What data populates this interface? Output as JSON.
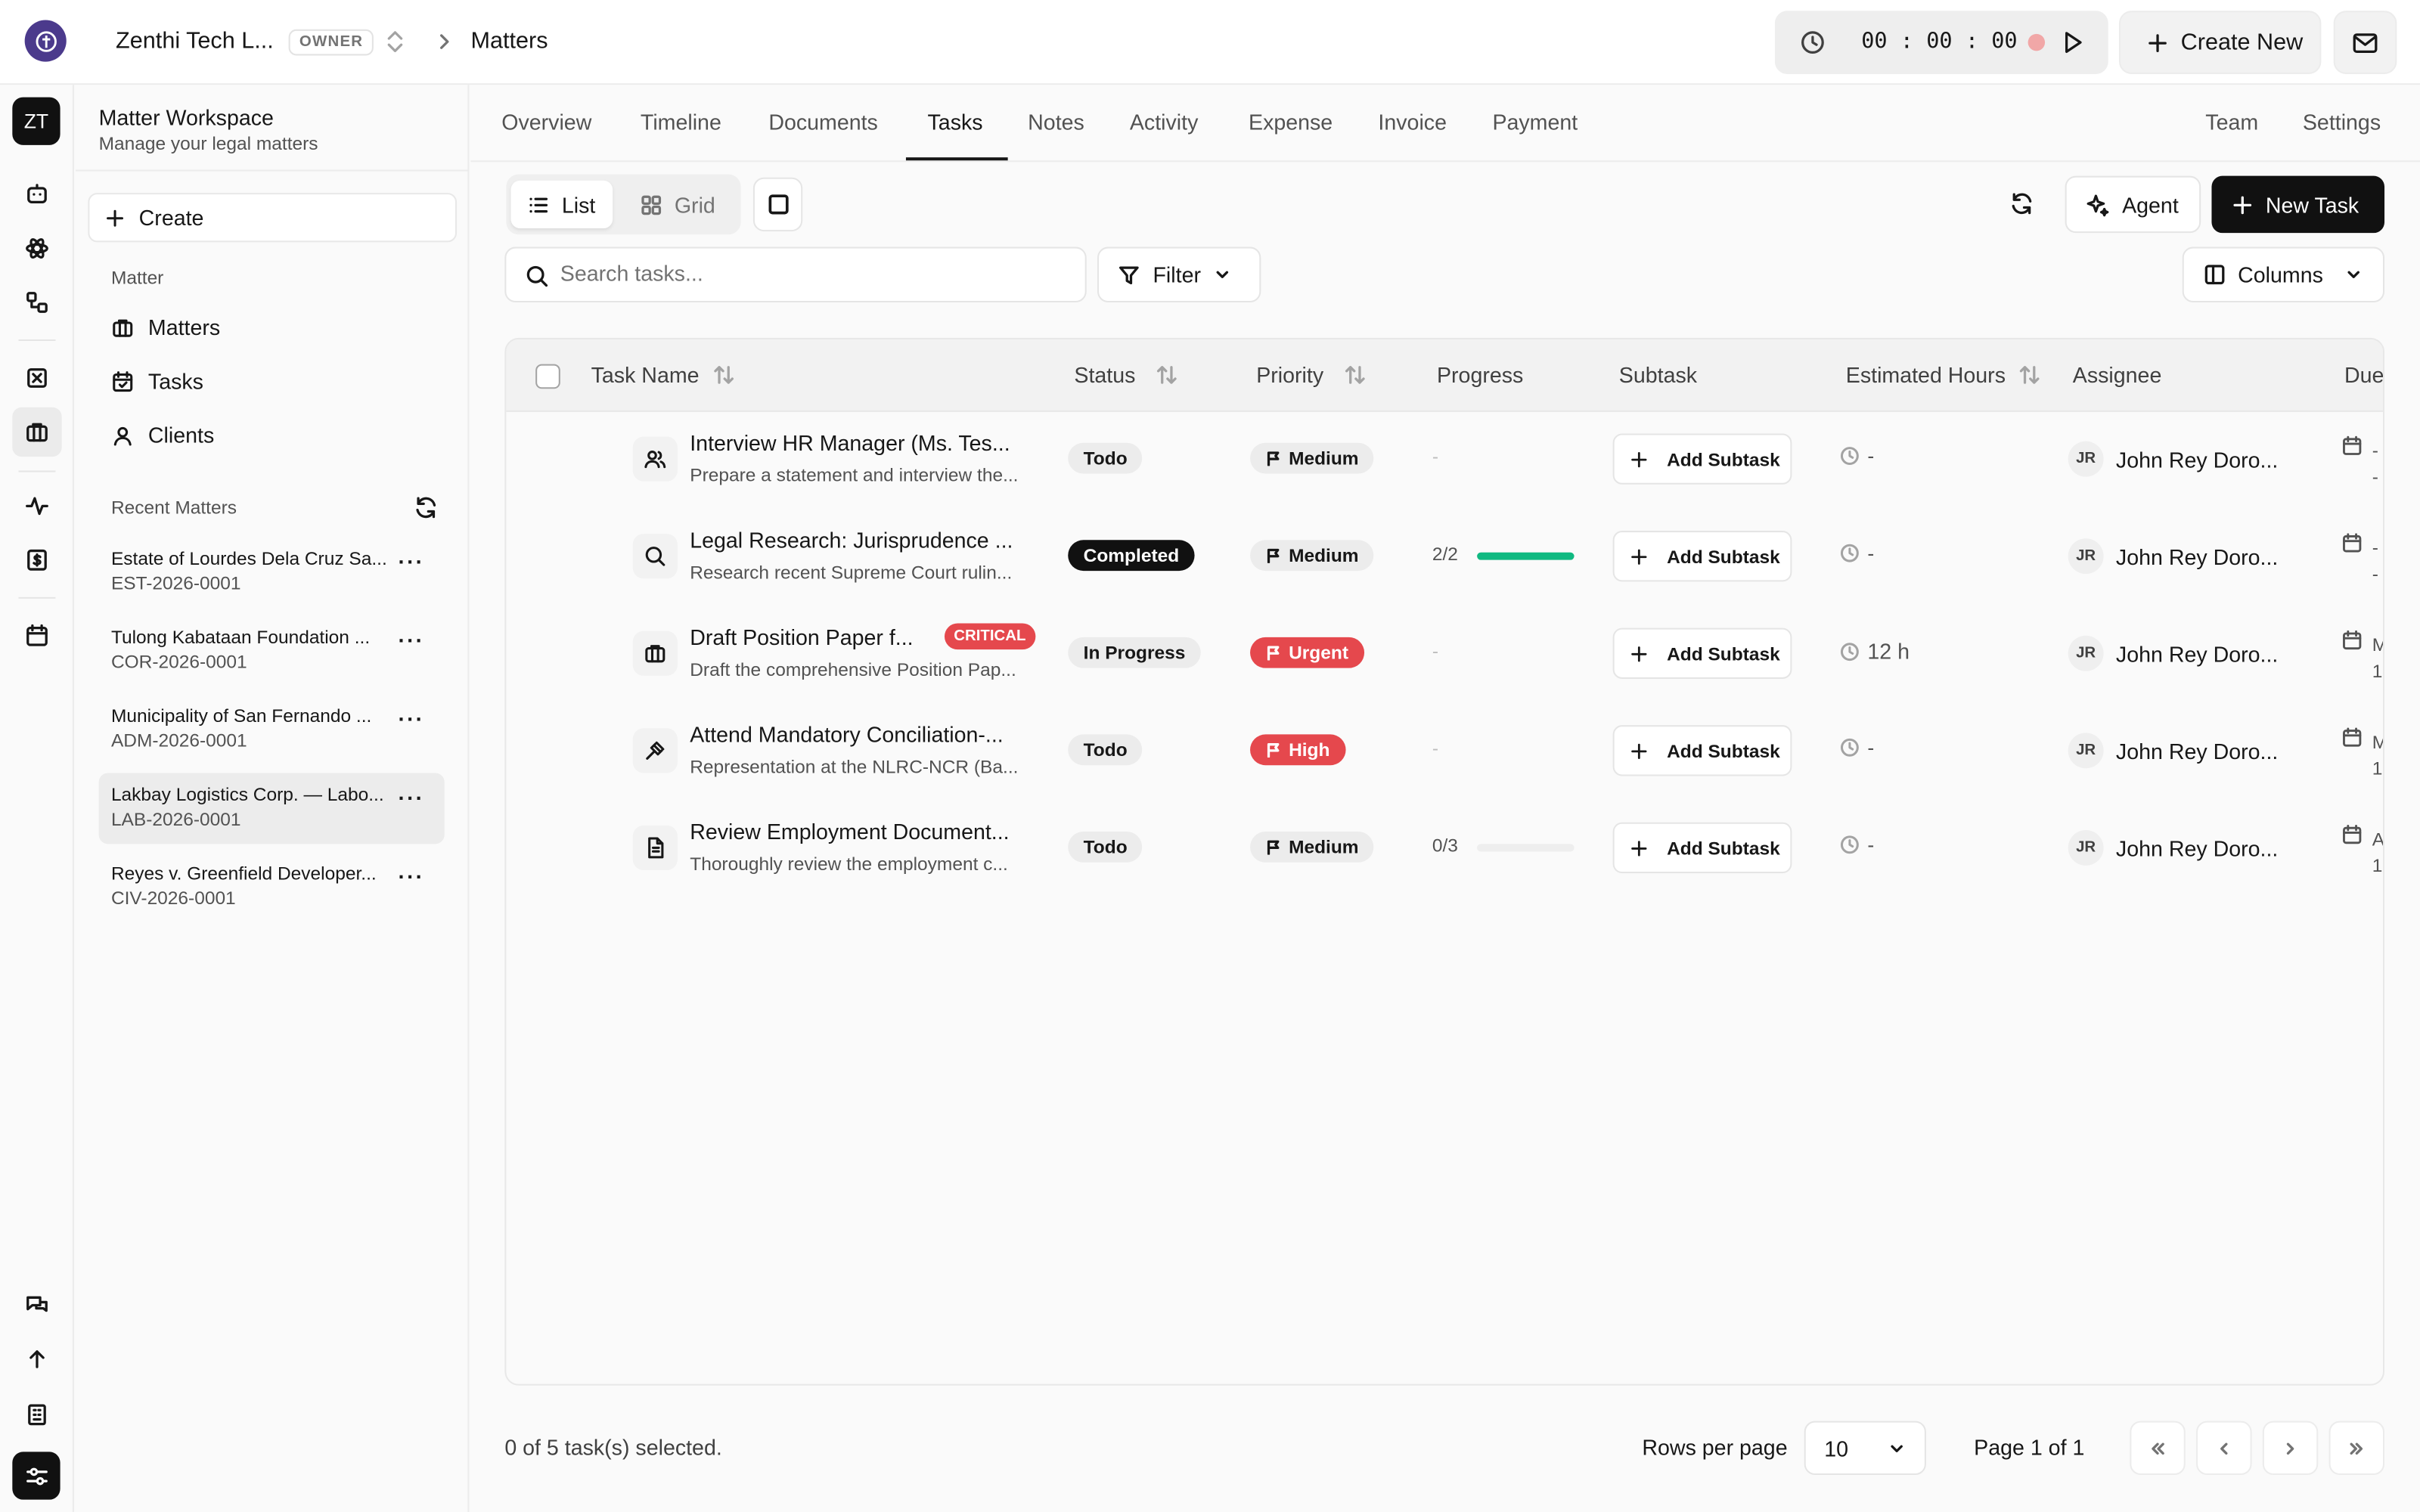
{
  "topbar": {
    "org_name": "Zenthi Tech L...",
    "owner_badge": "OWNER",
    "breadcrumb_current": "Matters",
    "timer": "00 : 00 : 00",
    "create_new": "Create New"
  },
  "rail": {
    "avatar": "ZT",
    "icons": [
      "chat-bot-icon",
      "atom-icon",
      "workflow-icon",
      "square-x-icon",
      "briefcase-icon",
      "activity-icon",
      "dollar-doc-icon",
      "calendar-icon",
      "messages-icon",
      "arrow-up-icon",
      "building-icon",
      "settings-sliders-icon"
    ]
  },
  "sidebar": {
    "title": "Matter Workspace",
    "subtitle": "Manage your legal matters",
    "create": "Create",
    "group_label": "Matter",
    "items": [
      {
        "label": "Matters",
        "icon": "briefcase-icon"
      },
      {
        "label": "Tasks",
        "icon": "calendar-check-icon"
      },
      {
        "label": "Clients",
        "icon": "user-icon"
      }
    ],
    "recent_label": "Recent Matters",
    "recent": [
      {
        "name": "Estate of Lourdes Dela Cruz Sa...",
        "code": "EST-2026-0001"
      },
      {
        "name": "Tulong Kabataan Foundation ...",
        "code": "COR-2026-0001"
      },
      {
        "name": "Municipality of San Fernando ...",
        "code": "ADM-2026-0001"
      },
      {
        "name": "Lakbay Logistics Corp. — Labo...",
        "code": "LAB-2026-0001"
      },
      {
        "name": "Reyes v. Greenfield Developer...",
        "code": "CIV-2026-0001"
      }
    ]
  },
  "tabs": {
    "items": [
      "Overview",
      "Timeline",
      "Documents",
      "Tasks",
      "Notes",
      "Activity",
      "Expense",
      "Invoice",
      "Payment"
    ],
    "right": [
      "Team",
      "Settings"
    ],
    "active": "Tasks"
  },
  "toolbar": {
    "list": "List",
    "grid": "Grid",
    "agent": "Agent",
    "new_task": "New Task",
    "search_placeholder": "Search tasks...",
    "filter": "Filter",
    "columns": "Columns"
  },
  "table": {
    "headers": {
      "task_name": "Task Name",
      "status": "Status",
      "priority": "Priority",
      "progress": "Progress",
      "subtask": "Subtask",
      "estimated_hours": "Estimated Hours",
      "assignee": "Assignee",
      "due": "Due"
    },
    "rows": [
      {
        "icon": "users-icon",
        "title": "Interview HR Manager (Ms. Tes...",
        "sub": "Prepare a statement and interview the...",
        "badge": "",
        "status": "Todo",
        "priority": "Medium",
        "progress": "-",
        "progress_fraction": null,
        "subtask": "Add Subtask",
        "est": "-",
        "assignee_initials": "JR",
        "assignee": "John Rey Doro...",
        "due": "- -"
      },
      {
        "icon": "search-icon",
        "title": "Legal Research: Jurisprudence ...",
        "sub": "Research recent Supreme Court rulin...",
        "badge": "",
        "status": "Completed",
        "priority": "Medium",
        "progress": "2/2",
        "progress_fraction": 1,
        "subtask": "Add Subtask",
        "est": "-",
        "assignee_initials": "JR",
        "assignee": "John Rey Doro...",
        "due": "- -"
      },
      {
        "icon": "briefcase-icon",
        "title": "Draft Position Paper f...",
        "sub": "Draft the comprehensive Position Pap...",
        "badge": "CRITICAL",
        "status": "In Progress",
        "priority": "Urgent",
        "progress": "-",
        "progress_fraction": null,
        "subtask": "Add Subtask",
        "est": "12 h",
        "assignee_initials": "JR",
        "assignee": "John Rey Doro...",
        "due": "M 1"
      },
      {
        "icon": "gavel-icon",
        "title": "Attend Mandatory Conciliation-...",
        "sub": "Representation at the NLRC-NCR (Ba...",
        "badge": "",
        "status": "Todo",
        "priority": "High",
        "progress": "-",
        "progress_fraction": null,
        "subtask": "Add Subtask",
        "est": "-",
        "assignee_initials": "JR",
        "assignee": "John Rey Doro...",
        "due": "M 1"
      },
      {
        "icon": "document-icon",
        "title": "Review Employment Document...",
        "sub": "Thoroughly review the employment c...",
        "badge": "",
        "status": "Todo",
        "priority": "Medium",
        "progress": "0/3",
        "progress_fraction": 0,
        "subtask": "Add Subtask",
        "est": "-",
        "assignee_initials": "JR",
        "assignee": "John Rey Doro...",
        "due": "A 1"
      }
    ]
  },
  "footer": {
    "selected": "0 of 5 task(s) selected.",
    "rows_per_page_label": "Rows per page",
    "rows_per_page": "10",
    "page_info": "Page 1 of 1"
  },
  "colors": {
    "accent_dark": "#111111",
    "urgent_red": "#e5484d",
    "progress_green": "#10b981",
    "org_logo": "#4b3a8c"
  }
}
